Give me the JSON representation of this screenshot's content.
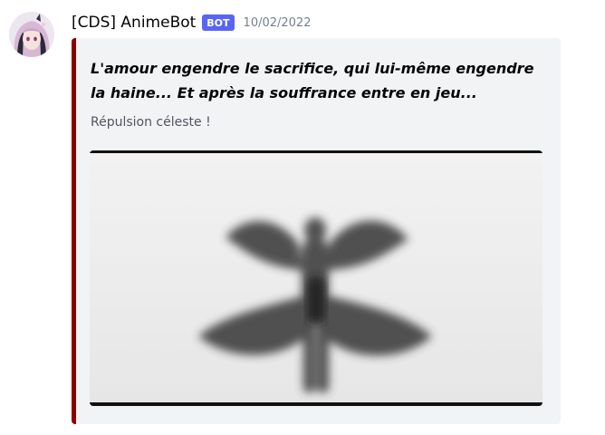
{
  "message": {
    "author": "[CDS] AnimeBot",
    "bot_tag": "BOT",
    "timestamp": "10/02/2022"
  },
  "embed": {
    "accent_color": "#8b0000",
    "title": "L'amour engendre le sacrifice, qui lui-même engendre la haine... Et après la souffrance entre en jeu...",
    "description": "Répulsion céleste !"
  },
  "colors": {
    "bot_tag": "#5865f2",
    "embed_background": "#f2f3f5"
  }
}
